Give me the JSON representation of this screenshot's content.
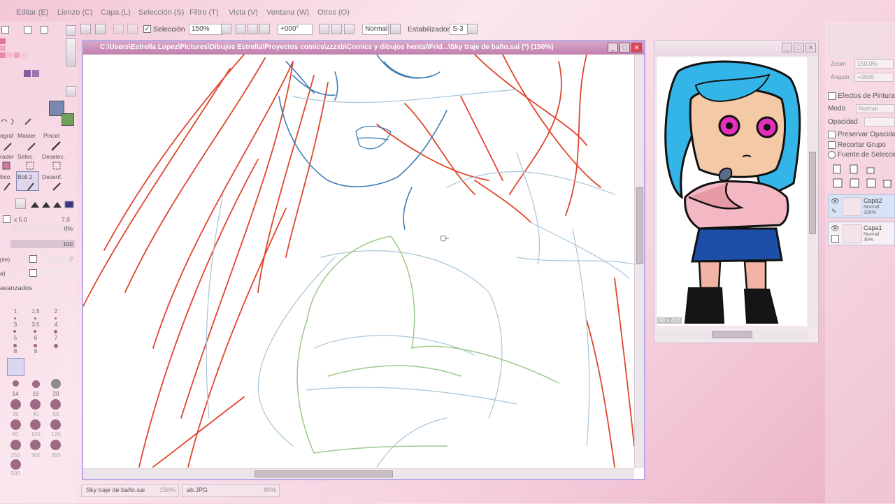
{
  "menu": [
    "Editar (E)",
    "Lienzo (C)",
    "Capa (L)",
    "Selección (S)",
    "Filtro (T)",
    "Vista (V)",
    "Ventana (W)",
    "Otros (O)"
  ],
  "toolbar": {
    "selection_label": "Selección",
    "zoom": "150%",
    "angle": "+000°",
    "blend_mode": "Normal",
    "stabilizer_label": "Estabilizador",
    "stabilizer_value": "S-3"
  },
  "left_panel": {
    "tools_row1": [
      "ográf",
      "Master",
      "Pincel"
    ],
    "tools_row2": [
      "rador",
      "Selec.",
      "Deselec."
    ],
    "tools_row3": [
      "llico",
      "Boli 2",
      "Desenf."
    ],
    "size_multiplier": "x 5.0",
    "size_value": "7.0",
    "density_value": "0%",
    "opacity_value": "100",
    "option1": "ple)",
    "option1_value": "0",
    "option2": "a)",
    "advanced_label": "avanzados",
    "brush_sizes": [
      "1",
      "1.5",
      "2",
      "3",
      "3.5",
      "4",
      "5",
      "6",
      "7",
      "8",
      "9",
      "14",
      "16",
      "20",
      "35",
      "40",
      "50",
      "80",
      "100",
      "120",
      "250",
      "300",
      "350",
      "500"
    ],
    "colors": {
      "primary": "#7b87b3",
      "secondary": "#6fa35c",
      "swatch_pink": "#e8859f",
      "swatch_purple": "#8a5a9e"
    }
  },
  "canvas_window": {
    "title": "C:\\Users\\Estrella Lopez\\Pictures\\Dibujos Estrella\\Proyectos comics\\zzzxb\\Comics y dibujos hentai\\Frid...\\Sky traje de baño.sai (*) (150%)",
    "cursor_icon": "brush-cursor-icon"
  },
  "navigator_window": {
    "size_label": "50 × 416"
  },
  "right_panel": {
    "zoom_label": "Zoom",
    "zoom_value": "150.0%",
    "angle_label": "Ángulo",
    "angle_value": "+0000",
    "effects_label": "Efectos de Pintura",
    "mode_label": "Modo",
    "mode_value": "Normal",
    "opacity_label": "Opacidad",
    "preserve_label": "Preservar Opacidad",
    "clip_label": "Recortar Grupo",
    "source_label": "Fuente de Selección",
    "layers": [
      {
        "name": "Capa2",
        "mode": "Normal",
        "opacity": "100%",
        "selected": true
      },
      {
        "name": "Capa1",
        "mode": "Normal",
        "opacity": "35%",
        "selected": false
      }
    ]
  },
  "bottom_tabs": [
    {
      "name": "Sky traje de baño.sai",
      "zoom": "150%"
    },
    {
      "name": "ab.JPG",
      "zoom": "80%"
    }
  ]
}
